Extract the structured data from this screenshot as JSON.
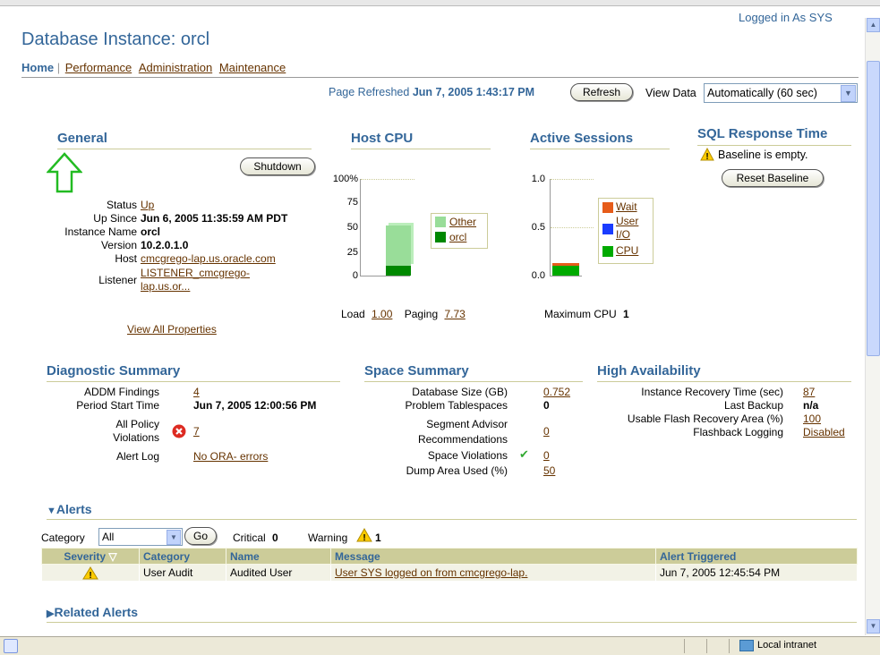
{
  "header": {
    "logged_in": "Logged in As SYS",
    "title": "Database Instance: orcl"
  },
  "tabs": [
    {
      "label": "Home"
    },
    {
      "label": "Performance"
    },
    {
      "label": "Administration"
    },
    {
      "label": "Maintenance"
    }
  ],
  "refresh": {
    "page_refreshed": "Page Refreshed",
    "timestamp": "Jun 7, 2005 1:43:17 PM",
    "refresh_label": "Refresh",
    "view_data_label": "View Data",
    "view_data_value": "Automatically (60 sec)"
  },
  "general": {
    "heading": "General",
    "shutdown_label": "Shutdown",
    "rows": [
      {
        "label": "Status",
        "value": "Up"
      },
      {
        "label": "Up Since",
        "value": "Jun 6, 2005 11:35:59 AM PDT"
      },
      {
        "label": "Instance Name",
        "value": "orcl"
      },
      {
        "label": "Version",
        "value": "10.2.0.1.0"
      },
      {
        "label": "Host",
        "value": "cmcgrego-lap.us.oracle.com"
      },
      {
        "label": "Listener",
        "value": "LISTENER_cmcgrego-",
        "value2": "lap.us.or..."
      }
    ],
    "view_all": "View All Properties"
  },
  "host_cpu": {
    "heading": "Host CPU",
    "ticks": [
      "100%",
      "75",
      "50",
      "25",
      "0"
    ],
    "legend": [
      "Other",
      "orcl"
    ],
    "load_label": "Load",
    "load_value": "1.00",
    "paging_label": "Paging",
    "paging_value": "7.73"
  },
  "active_sessions": {
    "heading": "Active Sessions",
    "ticks": [
      "1.0",
      "0.5",
      "0.0"
    ],
    "legend": [
      "Wait",
      "User",
      "I/O",
      "CPU"
    ],
    "max_cpu_label": "Maximum CPU",
    "max_cpu_value": "1"
  },
  "sql_response": {
    "heading": "SQL Response Time",
    "message": "Baseline is empty.",
    "reset_label": "Reset Baseline"
  },
  "diagnostic": {
    "heading": "Diagnostic Summary",
    "addm_label": "ADDM Findings",
    "addm_value": "4",
    "period_label": "Period Start Time",
    "period_value": "Jun 7, 2005 12:00:56 PM",
    "policy_label1": "All Policy",
    "policy_label2": "Violations",
    "policy_value": "7",
    "alert_log_label": "Alert Log",
    "alert_log_value": "No ORA- errors"
  },
  "space": {
    "heading": "Space Summary",
    "db_size_label": "Database Size (GB)",
    "db_size_value": "0.752",
    "problem_ts_label": "Problem Tablespaces",
    "problem_ts_value": "0",
    "seg_label1": "Segment Advisor",
    "seg_label2": "Recommendations",
    "seg_value": "0",
    "viol_label": "Space Violations",
    "viol_value": "0",
    "dump_label": "Dump Area Used (%)",
    "dump_value": "50"
  },
  "ha": {
    "heading": "High Availability",
    "irt_label": "Instance Recovery Time (sec)",
    "irt_value": "87",
    "backup_label": "Last Backup",
    "backup_value": "n/a",
    "flash_area_label": "Usable Flash Recovery Area (%)",
    "flash_area_value": "100",
    "flash_log_label": "Flashback Logging",
    "flash_log_value": "Disabled"
  },
  "alerts": {
    "heading": "Alerts",
    "category_label": "Category",
    "category_value": "All",
    "go_label": "Go",
    "critical_label": "Critical",
    "critical_value": "0",
    "warning_label": "Warning",
    "warning_value": "1",
    "columns": [
      "Severity",
      "Category",
      "Name",
      "Message",
      "Alert Triggered"
    ],
    "row": {
      "category": "User Audit",
      "name": "Audited User",
      "message": "User SYS logged on from cmcgrego-lap.",
      "triggered": "Jun 7, 2005 12:45:54 PM"
    }
  },
  "related_alerts": {
    "heading": "Related Alerts"
  },
  "statusbar": {
    "zone": "Local intranet"
  },
  "colors": {
    "heading": "#336699",
    "link": "#663300",
    "other": "#99dd99",
    "orcl": "#008800",
    "wait": "#e65c1a",
    "user_io": "#1a3cff",
    "cpu": "#00aa00"
  }
}
